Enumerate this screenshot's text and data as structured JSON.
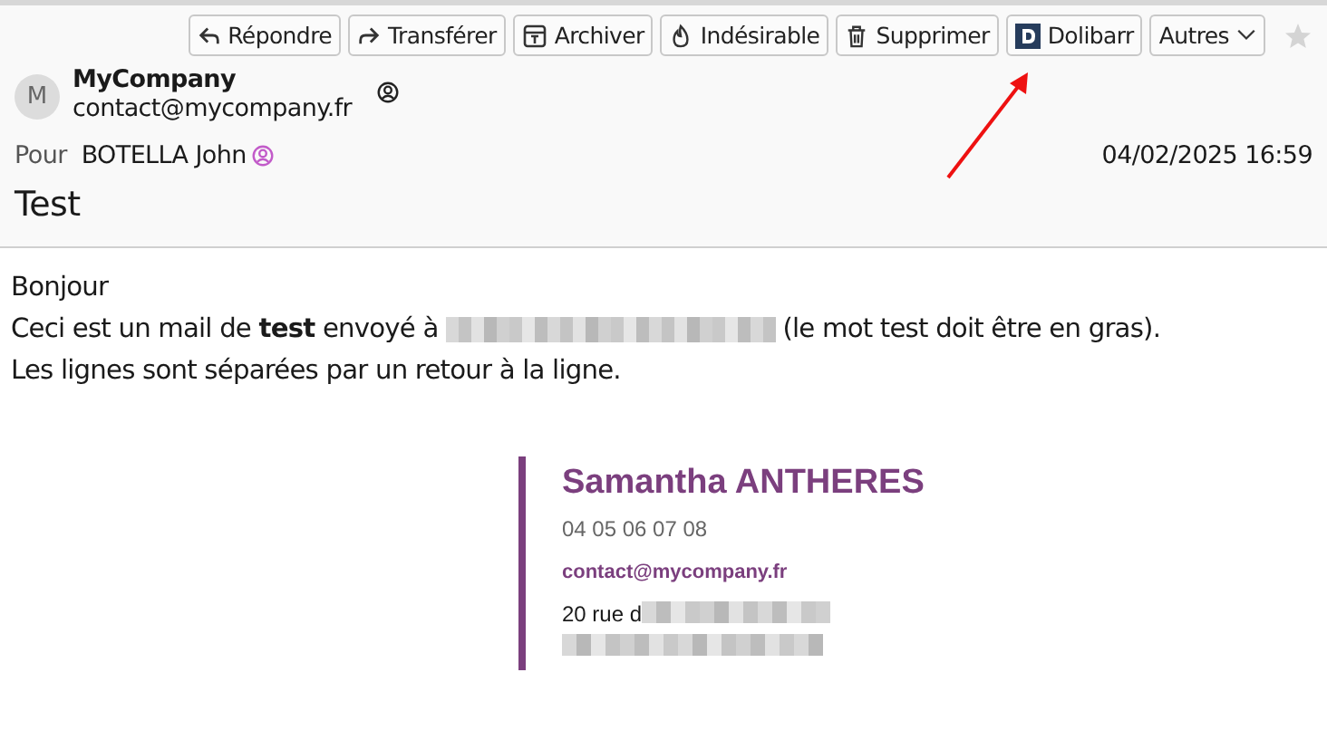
{
  "toolbar": [
    {
      "kind": "reply",
      "label": "Répondre"
    },
    {
      "kind": "forward",
      "label": "Transférer"
    },
    {
      "kind": "archive",
      "label": "Archiver"
    },
    {
      "kind": "junk",
      "label": "Indésirable"
    },
    {
      "kind": "delete",
      "label": "Supprimer"
    },
    {
      "kind": "logo",
      "label": "Dolibarr"
    },
    {
      "kind": "menu",
      "label": "Autres"
    }
  ],
  "starred": false,
  "sender": {
    "avatar": "M",
    "name": "MyCompany",
    "email": "contact@mycompany.fr"
  },
  "recipient": {
    "label": "Pour",
    "name": "BOTELLA John"
  },
  "date": "04/02/2025 16:59",
  "subject": "Test",
  "body": [
    {
      "before": "Bonjour"
    },
    {
      "before": "Ceci est un mail de **test** envoyé à",
      "redacted": true,
      "after": "(le mot test doit être en gras)."
    },
    {
      "before": "Les lignes sont séparées par un retour à la ligne."
    }
  ],
  "signature": {
    "name": "Samantha ANTHERES",
    "phone": "04 05 06 07 08",
    "email": "contact@mycompany.fr",
    "address": "20 rue d"
  }
}
